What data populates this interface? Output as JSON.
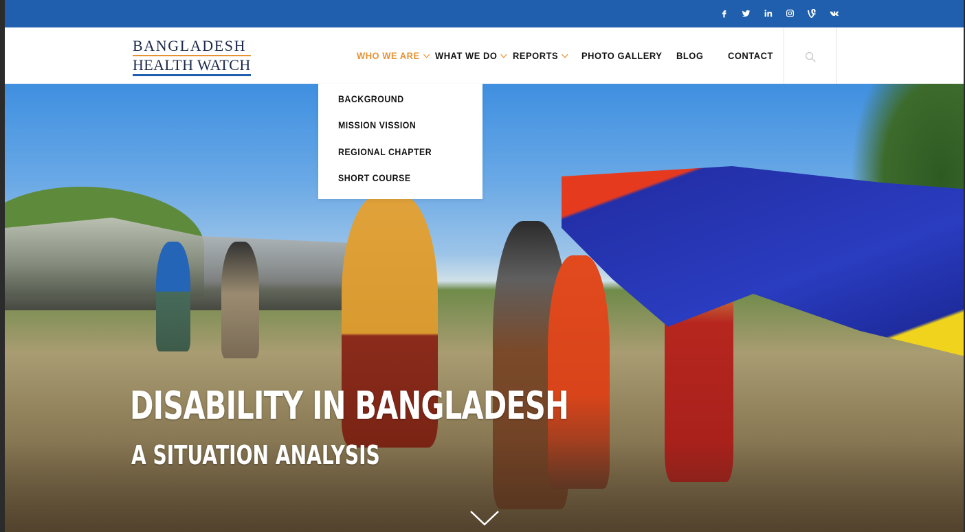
{
  "topbar": {
    "background": "#1f5fad",
    "social_icons": [
      "facebook-icon",
      "twitter-icon",
      "linkedin-icon",
      "instagram-icon",
      "vine-icon",
      "vk-icon"
    ]
  },
  "logo": {
    "line1": "BANGLADESH",
    "line2": "HEALTH WATCH",
    "accent_color": "#e79232",
    "brand_color": "#1f5fad"
  },
  "nav": {
    "items": [
      {
        "label": "WHO WE ARE",
        "has_dropdown": true,
        "active": true
      },
      {
        "label": "WHAT WE DO",
        "has_dropdown": true,
        "active": false
      },
      {
        "label": "REPORTS",
        "has_dropdown": true,
        "active": false
      },
      {
        "label": "PHOTO GALLERY",
        "has_dropdown": false,
        "active": false
      },
      {
        "label": "BLOG",
        "has_dropdown": false,
        "active": false
      },
      {
        "label": "CONTACT",
        "has_dropdown": false,
        "active": false
      }
    ],
    "active_color": "#e79232",
    "search_icon": "search-icon"
  },
  "dropdown": {
    "items": [
      "BACKGROUND",
      "MISSION VISSION",
      "REGIONAL CHAPTER",
      "SHORT COURSE"
    ]
  },
  "hero": {
    "title": "DISABILITY IN BANGLADESH",
    "subtitle": "A SITUATION ANALYSIS",
    "scroll_icon": "chevron-down-icon"
  }
}
